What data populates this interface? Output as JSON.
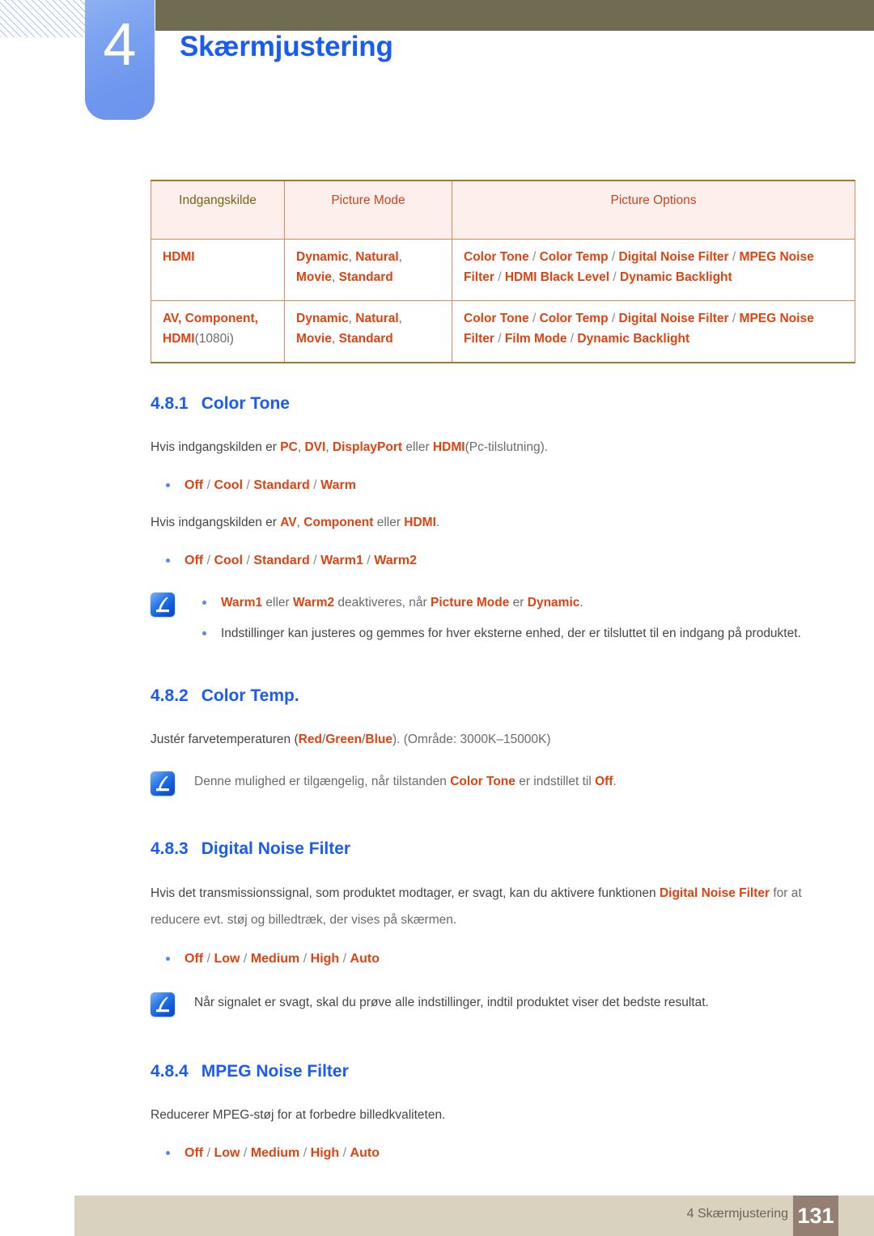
{
  "header": {
    "chapter_number": "4",
    "chapter_title": "Skærmjustering",
    "accent_blue": "#1a5cf0",
    "badge_blue": "#7ba2f0",
    "olive_bar": "#706c52"
  },
  "table": {
    "columns": [
      "Indgangskilde",
      "Picture Mode",
      "Picture Options"
    ],
    "rows": [
      {
        "source": "HDMI",
        "source_suffix": "",
        "mode": "Dynamic, Natural, Movie, Standard",
        "mode_parts": [
          "Dynamic",
          "Natural",
          "Movie",
          "Standard"
        ],
        "options": "Color Tone / Color Temp / Digital Noise Filter / MPEG Noise Filter / HDMI Black Level / Dynamic Backlight",
        "option_parts": [
          "Color Tone",
          "Color Temp",
          "Digital Noise Filter",
          "MPEG Noise Filter",
          "HDMI Black Level",
          "Dynamic Backlight"
        ]
      },
      {
        "source": "AV, Component, HDMI",
        "source_suffix": "(1080i)",
        "mode": "Dynamic, Natural, Movie, Standard",
        "mode_parts": [
          "Dynamic",
          "Natural",
          "Movie",
          "Standard"
        ],
        "options": "Color Tone / Color Temp / Digital Noise Filter / MPEG Noise Filter / Film Mode / Dynamic Backlight",
        "option_parts": [
          "Color Tone",
          "Color Temp",
          "Digital Noise Filter",
          "MPEG Noise Filter",
          "Film Mode",
          "Dynamic Backlight"
        ]
      }
    ]
  },
  "sections": [
    {
      "num": "4.8.1",
      "title": "Color Tone",
      "para1_lead": "Hvis indgangskilden er ",
      "para1_terms": [
        "PC",
        "DVI",
        "DisplayPort",
        "HDMI"
      ],
      "para1_tail": "(Pc-tilslutning).",
      "options1": [
        "Off",
        "Cool",
        "Standard",
        "Warm"
      ],
      "para2_lead": "Hvis indgangskilden er ",
      "para2_terms": [
        "AV",
        "Component",
        "HDMI"
      ],
      "para2_tail": ".",
      "options2": [
        "Off",
        "Cool",
        "Standard",
        "Warm1",
        "Warm2"
      ],
      "note_bullets": [
        {
          "text": "Warm1 eller Warm2 deaktiveres, når Picture Mode er Dynamic.",
          "highlights": [
            "Warm1",
            "Warm2",
            "Picture Mode",
            "Dynamic"
          ]
        },
        {
          "text": "Indstillinger kan justeres og gemmes for hver eksterne enhed, der er tilsluttet til en indgang på produktet.",
          "highlights": []
        }
      ]
    },
    {
      "num": "4.8.2",
      "title": "Color Temp.",
      "para_lead": "Justér farvetemperaturen (",
      "para_rgb": [
        "Red",
        "Green",
        "Blue"
      ],
      "para_tail": "). (Område: 3000K–15000K)",
      "note": {
        "text": "Denne mulighed er tilgængelig, når tilstanden Color Tone er indstillet til Off.",
        "highlights": [
          "Color Tone",
          "Off"
        ]
      }
    },
    {
      "num": "4.8.3",
      "title": "Digital Noise Filter",
      "para_lead": "Hvis det transmissionssignal, som produktet modtager, er svagt, kan du aktivere funktionen ",
      "para_term": "Digital Noise Filter",
      "para_tail": " for at reducere evt. støj og billedtræk, der vises på skærmen.",
      "options": [
        "Off",
        "Low",
        "Medium",
        "High",
        "Auto"
      ],
      "note": {
        "text": "Når signalet er svagt, skal du prøve alle indstillinger, indtil produktet viser det bedste resultat.",
        "highlights": []
      }
    },
    {
      "num": "4.8.4",
      "title": "MPEG Noise Filter",
      "para": "Reducerer MPEG-støj for at forbedre billedkvaliteten.",
      "options": [
        "Off",
        "Low",
        "Medium",
        "High",
        "Auto"
      ]
    }
  ],
  "footer": {
    "chapter_ref": "4 Skærmjustering",
    "page_number": "131",
    "bar_color": "#d8d2be",
    "page_box_color": "#938073"
  }
}
